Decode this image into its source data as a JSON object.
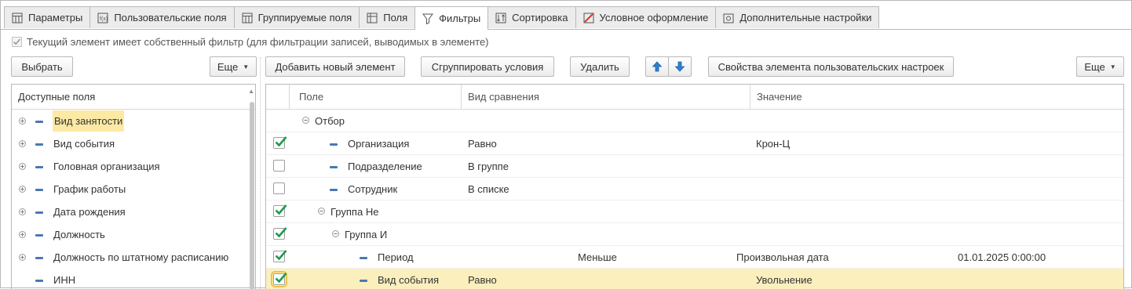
{
  "tabs": [
    {
      "label": "Параметры",
      "icon": "parameters-icon"
    },
    {
      "label": "Пользовательские поля",
      "icon": "custom-fields-icon"
    },
    {
      "label": "Группируемые поля",
      "icon": "grouping-fields-icon"
    },
    {
      "label": "Поля",
      "icon": "fields-icon"
    },
    {
      "label": "Фильтры",
      "icon": "filter-icon",
      "active": true
    },
    {
      "label": "Сортировка",
      "icon": "sort-icon"
    },
    {
      "label": "Условное оформление",
      "icon": "conditional-format-icon"
    },
    {
      "label": "Дополнительные настройки",
      "icon": "settings-icon"
    }
  ],
  "own_filter_label": "Текущий элемент имеет собственный фильтр (для фильтрации записей, выводимых в элементе)",
  "left_toolbar": {
    "select": "Выбрать",
    "more": "Еще"
  },
  "right_toolbar": {
    "add": "Добавить новый элемент",
    "group": "Сгруппировать условия",
    "delete": "Удалить",
    "properties": "Свойства элемента пользовательских настроек",
    "more": "Еще"
  },
  "available_fields": {
    "header": "Доступные поля",
    "items": [
      {
        "label": "Вид занятости",
        "expandable": true,
        "highlight": true
      },
      {
        "label": "Вид события",
        "expandable": true
      },
      {
        "label": "Головная организация",
        "expandable": true
      },
      {
        "label": "График работы",
        "expandable": true
      },
      {
        "label": "Дата рождения",
        "expandable": true
      },
      {
        "label": "Должность",
        "expandable": true
      },
      {
        "label": "Должность по штатному расписанию",
        "expandable": true
      },
      {
        "label": "ИНН",
        "expandable": false
      }
    ]
  },
  "filter_grid": {
    "columns": {
      "field": "Поле",
      "comparison": "Вид сравнения",
      "value": "Значение"
    },
    "rows": [
      {
        "type": "group",
        "level": 0,
        "checkbox": false,
        "field": "Отбор",
        "comparison": "",
        "value": ""
      },
      {
        "type": "item",
        "level": 1,
        "checked": true,
        "field": "Организация",
        "comparison": "Равно",
        "value": "Крон-Ц"
      },
      {
        "type": "item",
        "level": 1,
        "checked": false,
        "field": "Подразделение",
        "comparison": "В группе",
        "value": ""
      },
      {
        "type": "item",
        "level": 1,
        "checked": false,
        "field": "Сотрудник",
        "comparison": "В списке",
        "value": ""
      },
      {
        "type": "group",
        "level": 1,
        "checked": true,
        "field": "Группа Не",
        "comparison": "",
        "value": ""
      },
      {
        "type": "group",
        "level": 2,
        "checked": true,
        "field": "Группа И",
        "comparison": "",
        "value": ""
      },
      {
        "type": "item",
        "level": 3,
        "checked": true,
        "field": "Период",
        "comparison": "Меньше",
        "value": "Произвольная дата",
        "extra": "01.01.2025 0:00:00",
        "shifted": true
      },
      {
        "type": "item",
        "level": 3,
        "checked": true,
        "field": "Вид события",
        "comparison": "Равно",
        "value": "Увольнение",
        "selected": true
      }
    ]
  },
  "colors": {
    "accent": "#1b9a4a",
    "selection": "#fbefbe",
    "highlight": "#fce9a4",
    "tree_dash": "#4a77b4"
  }
}
